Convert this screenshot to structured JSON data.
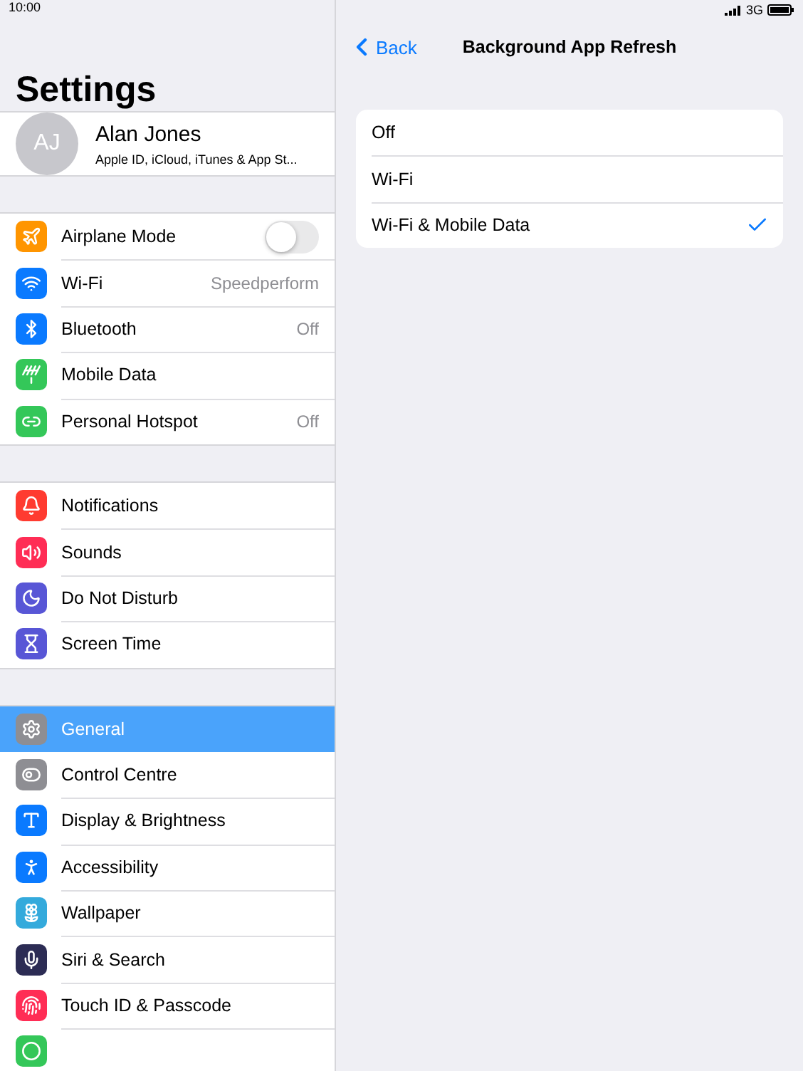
{
  "status_bar": {
    "time": "10:00",
    "network": "3G"
  },
  "sidebar": {
    "title": "Settings",
    "profile": {
      "initials": "AJ",
      "name": "Alan Jones",
      "subtitle": "Apple ID, iCloud, iTunes & App St..."
    },
    "groups": [
      {
        "items": [
          {
            "label": "Airplane Mode",
            "kind": "toggle",
            "on": false,
            "color": "#ff9500",
            "selected": false
          },
          {
            "label": "Wi-Fi",
            "kind": "value",
            "value": "Speedperform",
            "color": "#0a7aff",
            "selected": false
          },
          {
            "label": "Bluetooth",
            "kind": "value",
            "value": "Off",
            "color": "#0a7aff",
            "selected": false
          },
          {
            "label": "Mobile Data",
            "kind": "plain",
            "color": "#34c759",
            "selected": false
          },
          {
            "label": "Personal Hotspot",
            "kind": "value",
            "value": "Off",
            "color": "#34c759",
            "selected": false
          }
        ]
      },
      {
        "items": [
          {
            "label": "Notifications",
            "kind": "plain",
            "color": "#ff3b30",
            "selected": false
          },
          {
            "label": "Sounds",
            "kind": "plain",
            "color": "#ff2d55",
            "selected": false
          },
          {
            "label": "Do Not Disturb",
            "kind": "plain",
            "color": "#5856d6",
            "selected": false
          },
          {
            "label": "Screen Time",
            "kind": "plain",
            "color": "#5856d6",
            "selected": false
          }
        ]
      },
      {
        "items": [
          {
            "label": "General",
            "kind": "plain",
            "color": "#8e8e93",
            "selected": true
          },
          {
            "label": "Control Centre",
            "kind": "plain",
            "color": "#8e8e93",
            "selected": false
          },
          {
            "label": "Display & Brightness",
            "kind": "plain",
            "color": "#0a7aff",
            "selected": false
          },
          {
            "label": "Accessibility",
            "kind": "plain",
            "color": "#0a7aff",
            "selected": false
          },
          {
            "label": "Wallpaper",
            "kind": "plain",
            "color": "#34aadc",
            "selected": false
          },
          {
            "label": "Siri & Search",
            "kind": "plain",
            "color": "#2c2c54",
            "selected": false
          },
          {
            "label": "Touch ID & Passcode",
            "kind": "plain",
            "color": "#ff2d55",
            "selected": false
          },
          {
            "kind": "cut",
            "color": "#34c759",
            "selected": false
          }
        ]
      }
    ]
  },
  "detail": {
    "back": "Back",
    "title": "Background App Refresh",
    "options": [
      {
        "label": "Off",
        "selected": false
      },
      {
        "label": "Wi-Fi",
        "selected": false
      },
      {
        "label": "Wi-Fi & Mobile Data",
        "selected": true
      }
    ]
  }
}
